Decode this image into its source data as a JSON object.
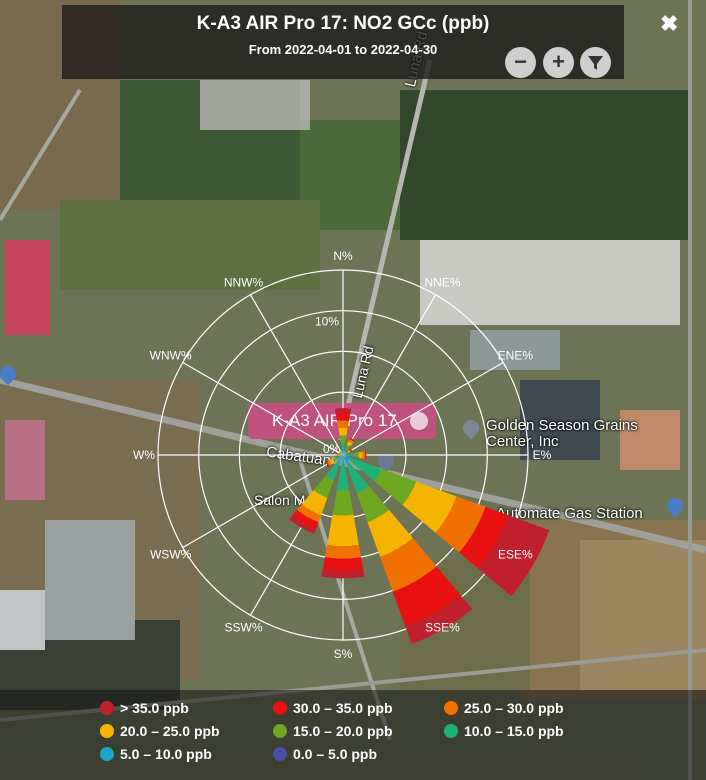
{
  "header": {
    "title": "K-A3 AIR Pro 17: NO2 GCc (ppb)",
    "subtitle": "From 2022-04-01 to 2022-04-30"
  },
  "controls": {
    "close": "✖",
    "zoom_out": "−",
    "zoom_in": "+",
    "filter": "filter-icon"
  },
  "map_labels": {
    "road": "Luna Rd",
    "road2": "Luna Rd",
    "place1": "Golden Season Grains Center, Inc",
    "place2": "Automate Gas Station",
    "place3": "Cabatuan",
    "place4": "Salon M"
  },
  "marker": {
    "label": "K-A3 AIR Pro 17"
  },
  "rose": {
    "directions": [
      "N%",
      "NNE%",
      "ENE%",
      "E%",
      "ESE%",
      "SSE%",
      "S%",
      "SSW%",
      "WSW%",
      "W%",
      "WNW%",
      "NNW%"
    ],
    "ring_labels": [
      "0%",
      "10%"
    ]
  },
  "chart_data": {
    "type": "wind-rose",
    "title": "K-A3 AIR Pro 17: NO2 GCc (ppb)",
    "subtitle": "From 2022-04-01 to 2022-04-30",
    "directions": [
      "N",
      "NNE",
      "ENE",
      "E",
      "ESE",
      "SSE",
      "S",
      "SSW",
      "WSW",
      "W",
      "WNW",
      "NNW"
    ],
    "bins": [
      "0.0 – 5.0 ppb",
      "5.0 – 10.0 ppb",
      "10.0 – 15.0 ppb",
      "15.0 – 20.0 ppb",
      "20.0 – 25.0 ppb",
      "25.0 – 30.0 ppb",
      "30.0 – 35.0 ppb",
      "> 35.0 ppb"
    ],
    "colors": [
      "#4b4fa8",
      "#1ea6c8",
      "#21b07a",
      "#6ea820",
      "#f4b400",
      "#f07000",
      "#e81010",
      "#c01f2e"
    ],
    "series_pct": {
      "N": [
        0.2,
        0.3,
        0.5,
        0.6,
        0.6,
        0.6,
        0.6,
        0.4
      ],
      "NNE": [
        0.1,
        0.2,
        0.3,
        0.3,
        0.3,
        0.2,
        0.1,
        0.0
      ],
      "ENE": [
        0.0,
        0.1,
        0.2,
        0.2,
        0.1,
        0.1,
        0.1,
        0.0
      ],
      "E": [
        0.1,
        0.3,
        0.5,
        0.4,
        0.3,
        0.2,
        0.1,
        0.0
      ],
      "ESE": [
        0.2,
        0.6,
        2.5,
        3.0,
        3.5,
        2.5,
        2.0,
        3.5
      ],
      "SSE": [
        0.2,
        0.6,
        2.5,
        2.5,
        3.0,
        3.0,
        3.0,
        1.5
      ],
      "S": [
        0.2,
        0.5,
        2.2,
        2.0,
        2.5,
        1.0,
        1.0,
        0.6
      ],
      "SSW": [
        0.2,
        0.5,
        1.5,
        1.5,
        1.5,
        0.6,
        0.6,
        0.4
      ],
      "WSW": [
        0.1,
        0.2,
        0.3,
        0.3,
        0.3,
        0.2,
        0.1,
        0.0
      ],
      "W": [
        0.0,
        0.1,
        0.1,
        0.1,
        0.1,
        0.1,
        0.0,
        0.0
      ],
      "WNW": [
        0.0,
        0.1,
        0.1,
        0.1,
        0.0,
        0.0,
        0.0,
        0.0
      ],
      "NNW": [
        0.0,
        0.1,
        0.1,
        0.1,
        0.1,
        0.0,
        0.0,
        0.0
      ]
    },
    "ring_max_pct": 15,
    "ring_labels": [
      "0%",
      "10%"
    ]
  },
  "legend": [
    {
      "label": "> 35.0 ppb",
      "color": "#c01f2e"
    },
    {
      "label": "30.0 – 35.0 ppb",
      "color": "#e81010"
    },
    {
      "label": "25.0 – 30.0 ppb",
      "color": "#f07000"
    },
    {
      "label": "20.0 – 25.0 ppb",
      "color": "#f4b400"
    },
    {
      "label": "15.0 – 20.0 ppb",
      "color": "#6ea820"
    },
    {
      "label": "10.0 – 15.0 ppb",
      "color": "#21b07a"
    },
    {
      "label": "5.0 – 10.0 ppb",
      "color": "#1ea6c8"
    },
    {
      "label": "0.0 – 5.0 ppb",
      "color": "#4b4fa8"
    }
  ]
}
